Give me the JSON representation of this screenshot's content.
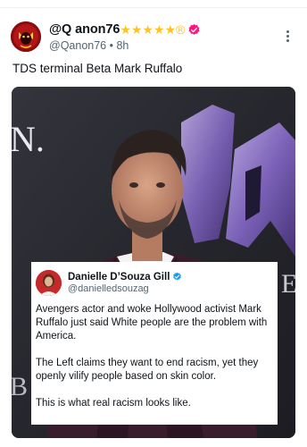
{
  "post": {
    "display_name": "@Q anon76",
    "name_decorations": "★★★★★®",
    "handle": "@Qanon76",
    "separator": "•",
    "time": "8h",
    "text": "TDS terminal Beta Mark Ruffalo"
  },
  "media": {
    "background_letters_left": "N.",
    "background_letters_right": "E",
    "background_letters_bottom_left": "B"
  },
  "quote": {
    "display_name": "Danielle D’Souza Gill",
    "handle": "@danielledsouzag",
    "paragraphs": [
      "Avengers actor and woke Hollywood activist Mark Ruffalo just said White people are the problem with America.",
      "The Left claims they want to end racism, yet they openly vilify people based on skin color.",
      "This is what real racism looks like."
    ]
  },
  "colors": {
    "verified_badge": "#f91880",
    "quote_verified_badge": "#1d9bf0",
    "stars": "#ffc41f",
    "secondary_text": "#536471"
  },
  "icons": {
    "more": "more-vertical-icon",
    "verified": "verified-badge-icon"
  }
}
